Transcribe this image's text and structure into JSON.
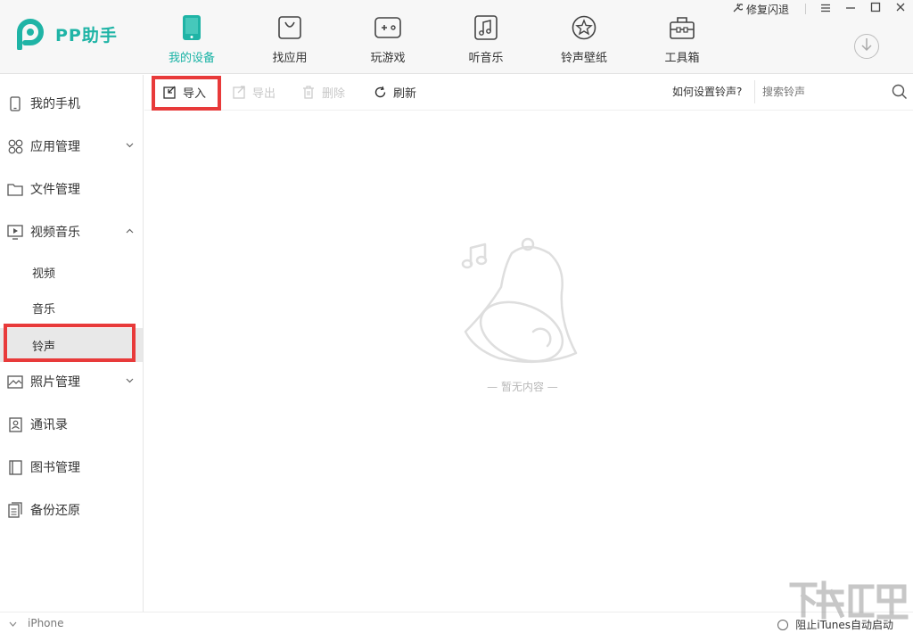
{
  "app": {
    "name": "PP助手"
  },
  "window": {
    "repair_label": "修复闪退"
  },
  "nav": [
    {
      "label": "我的设备",
      "icon": "phone-icon",
      "active": true
    },
    {
      "label": "找应用",
      "icon": "app-bag-icon",
      "active": false
    },
    {
      "label": "玩游戏",
      "icon": "gamepad-icon",
      "active": false
    },
    {
      "label": "听音乐",
      "icon": "music-note-icon",
      "active": false
    },
    {
      "label": "铃声壁纸",
      "icon": "star-icon",
      "active": false
    },
    {
      "label": "工具箱",
      "icon": "toolbox-icon",
      "active": false
    }
  ],
  "sidebar": {
    "items": [
      {
        "label": "我的手机",
        "icon": "phone-outline-icon"
      },
      {
        "label": "应用管理",
        "icon": "apps-grid-icon"
      },
      {
        "label": "文件管理",
        "icon": "folder-icon"
      },
      {
        "label": "视频音乐",
        "icon": "video-icon"
      },
      {
        "label": "照片管理",
        "icon": "photo-icon"
      },
      {
        "label": "通讯录",
        "icon": "contacts-icon"
      },
      {
        "label": "图书管理",
        "icon": "book-icon"
      },
      {
        "label": "备份还原",
        "icon": "backup-icon"
      }
    ],
    "subitems": [
      {
        "label": "视频"
      },
      {
        "label": "音乐"
      },
      {
        "label": "铃声",
        "selected": true
      }
    ]
  },
  "toolbar": {
    "import_label": "导入",
    "export_label": "导出",
    "delete_label": "删除",
    "refresh_label": "刷新",
    "help_label": "如何设置铃声?",
    "search_placeholder": "搜索铃声"
  },
  "content": {
    "empty_text": "— 暂无内容 —"
  },
  "status": {
    "device_name": "iPhone",
    "itunes_label": "阻止iTunes自动启动"
  },
  "colors": {
    "accent": "#1fb4a6",
    "highlight": "#e83a3a"
  }
}
